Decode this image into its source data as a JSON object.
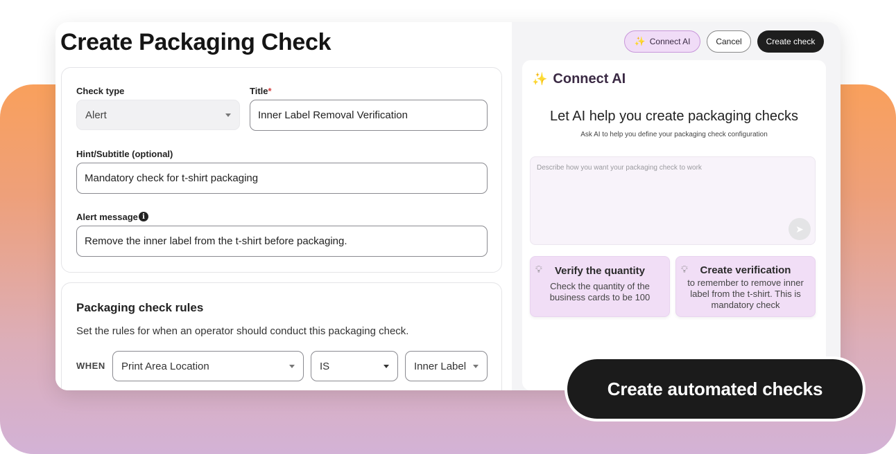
{
  "page": {
    "title": "Create Packaging Check"
  },
  "form": {
    "check_type_label": "Check type",
    "check_type_value": "Alert",
    "title_label": "Title",
    "title_required": "*",
    "title_value": "Inner Label Removal Verification",
    "hint_label": "Hint/Subtitle (optional)",
    "hint_value": "Mandatory check for t-shirt packaging",
    "alert_label": "Alert message",
    "alert_info_icon": "i",
    "alert_value": "Remove the inner label from the t-shirt before packaging."
  },
  "rules": {
    "title": "Packaging check rules",
    "description": "Set the rules for when an operator should conduct this packaging check.",
    "when_label": "WHEN",
    "field_value": "Print Area Location",
    "operator_value": "IS",
    "match_value": "Inner Label"
  },
  "header_actions": {
    "connect_ai": "Connect AI",
    "cancel": "Cancel",
    "create_check": "Create check"
  },
  "ai_panel": {
    "title": "Connect AI",
    "heading": "Let AI help you create packaging checks",
    "subheading": "Ask AI to help you define your packaging check configuration",
    "prompt_placeholder": "Describe how you want your packaging check to work",
    "suggestions": [
      {
        "title": "Verify the quantity",
        "body": "Check the quantity of the business cards to be 100"
      },
      {
        "title": "Create verification",
        "body": "to remember to remove inner label from the t-shirt. This is mandatory check"
      }
    ]
  },
  "cta": {
    "label": "Create automated checks"
  },
  "icons": {
    "wand": "magic-wand-icon",
    "bulb": "lightbulb-icon",
    "send": "send-icon",
    "info": "info-icon",
    "caret": "chevron-down-icon"
  },
  "colors": {
    "accent_purple": "#f0dcf7",
    "dark_button": "#1e1e1e",
    "gradient_top": "#f9a05c",
    "gradient_bottom": "#d3b2d6"
  }
}
